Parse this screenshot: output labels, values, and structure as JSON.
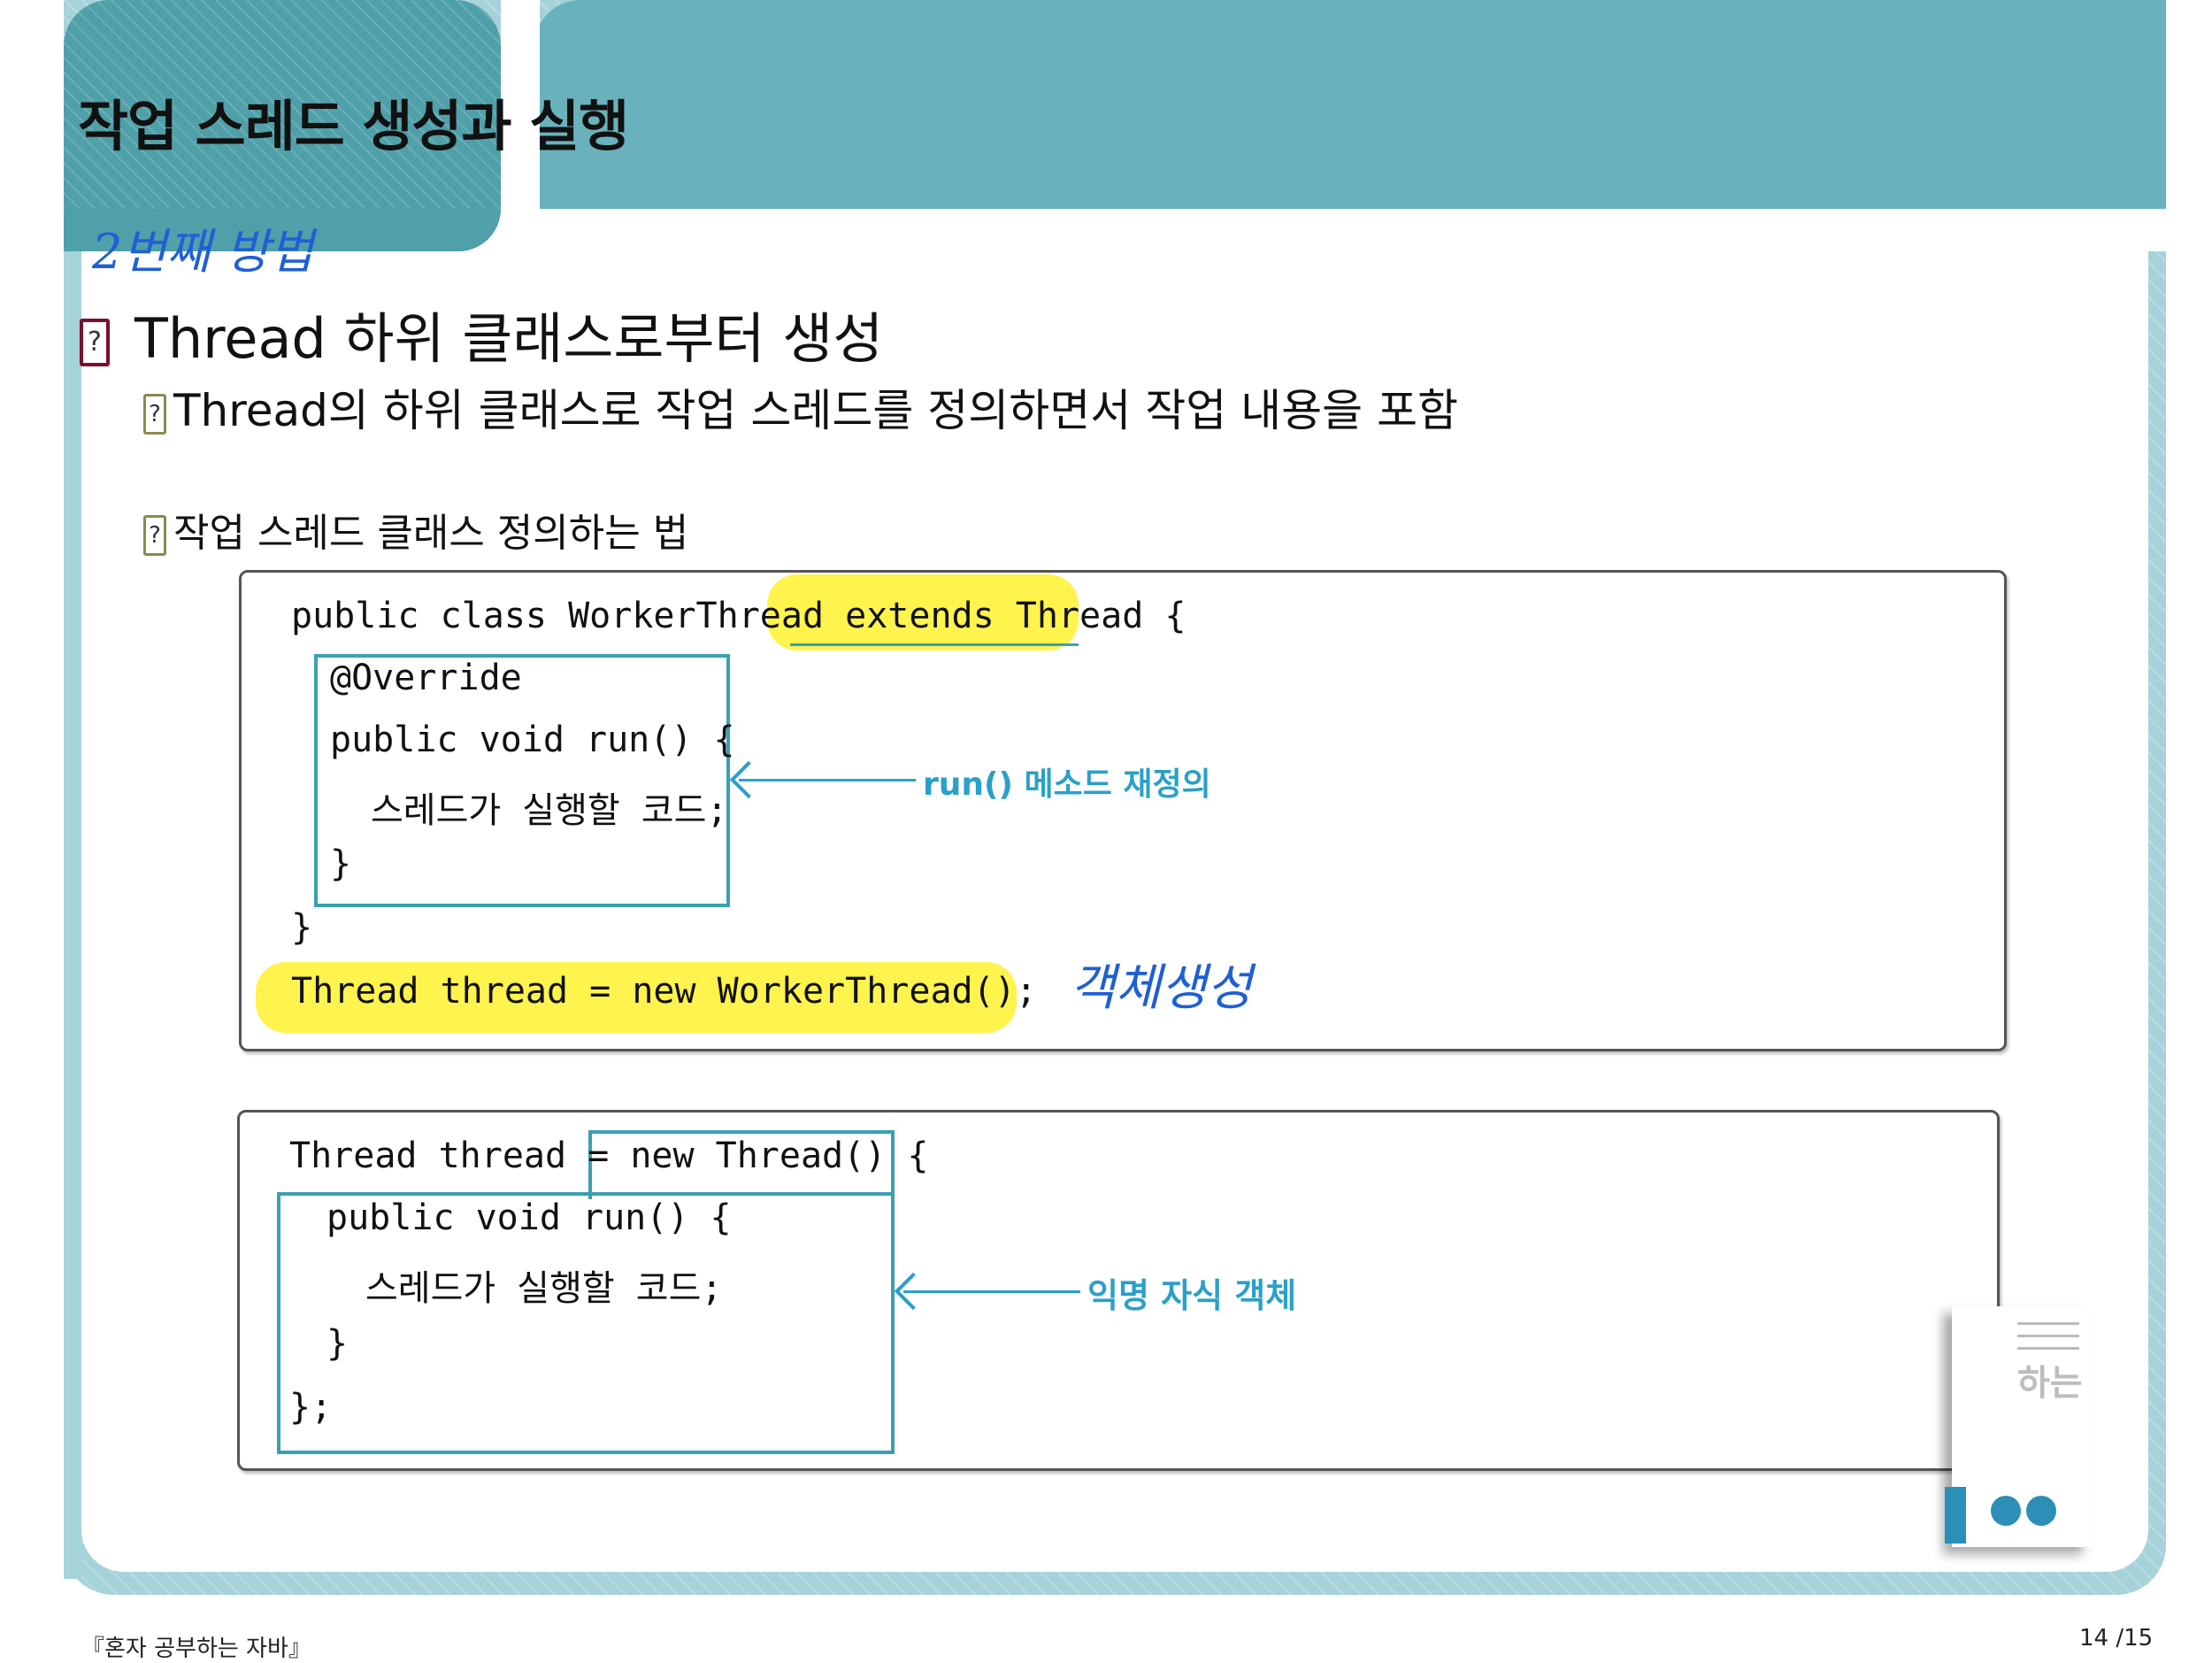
{
  "slide": {
    "title": "작업 스레드 생성과 실행",
    "handwritten_top": "2번째 방법"
  },
  "icon": "question-box-icon",
  "icon_glyph": "?",
  "heading": "Thread 하위 클래스로부터 생성",
  "bullets": [
    "Thread의 하위 클래스로 작업 스레드를 정의하면서 작업 내용을 포함",
    "작업 스레드 클래스 정의하는 법"
  ],
  "code1": {
    "line1_a": "public class WorkerThread ",
    "line1_b": "extends Thread",
    "line1_c": " {",
    "line2": "@Override",
    "line3": "public void run() {",
    "line4": "스레드가 실행할 코드;",
    "line5": "}",
    "line6": "}",
    "line7": "Thread thread = new WorkerThread();",
    "note_arrow": "run() 메소드 재정의",
    "note_hand": "객체생성"
  },
  "code2": {
    "line1_a": "Thread thread = ",
    "line1_b": "new Thread() {",
    "line2": "public void run() {",
    "line3": "스레드가 실행할 코드;",
    "line4": "}",
    "line5": "};",
    "note_arrow": "익명 자식 객체"
  },
  "book_cover_text": "하는",
  "footer": {
    "left": "『혼자 공부하는 자바』",
    "right": "14 /15"
  }
}
